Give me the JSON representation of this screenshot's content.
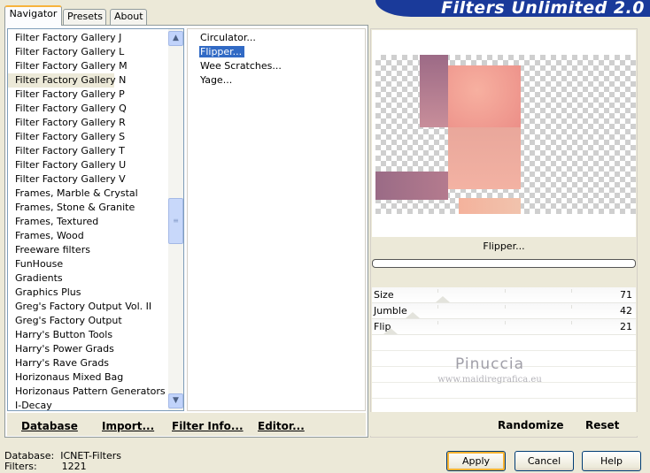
{
  "tabs": [
    "Navigator",
    "Presets",
    "About"
  ],
  "banner_title": "Filters Unlimited 2.0",
  "categories": [
    "Filter Factory Gallery J",
    "Filter Factory Gallery L",
    "Filter Factory Gallery M",
    "Filter Factory Gallery N",
    "Filter Factory Gallery P",
    "Filter Factory Gallery Q",
    "Filter Factory Gallery R",
    "Filter Factory Gallery S",
    "Filter Factory Gallery T",
    "Filter Factory Gallery U",
    "Filter Factory Gallery V",
    "Frames, Marble & Crystal",
    "Frames, Stone & Granite",
    "Frames, Textured",
    "Frames, Wood",
    "Freeware filters",
    "FunHouse",
    "Gradients",
    "Graphics Plus",
    "Greg's Factory Output Vol. II",
    "Greg's Factory Output",
    "Harry's Button Tools",
    "Harry's Power Grads",
    "Harry's Rave Grads",
    "Horizonaus Mixed Bag",
    "Horizonaus Pattern Generators",
    "I-Decay"
  ],
  "selected_category": "Filter Factory Gallery N",
  "filters": [
    "Circulator...",
    "Flipper...",
    "Wee Scratches...",
    "Yage..."
  ],
  "selected_filter": "Flipper...",
  "left_buttons": {
    "database": "Database",
    "import": "Import...",
    "filter_info": "Filter Info...",
    "editor": "Editor..."
  },
  "preview_filter_name": "Flipper...",
  "progress": 0,
  "params": [
    {
      "name": "Size",
      "value": "71"
    },
    {
      "name": "Jumble",
      "value": "42"
    },
    {
      "name": "Flip",
      "value": "21"
    }
  ],
  "watermark": {
    "line1": "Pinuccia",
    "line2": "www.maidiregrafica.eu"
  },
  "right_buttons": {
    "randomize": "Randomize",
    "reset": "Reset"
  },
  "status": {
    "database_label": "Database:",
    "database_value": "ICNET-Filters",
    "filters_label": "Filters:",
    "filters_value": "1221"
  },
  "dialog_buttons": {
    "apply": "Apply",
    "cancel": "Cancel",
    "help": "Help"
  },
  "colors": {
    "banner": "#1a3a9a",
    "selection": "#316ac5",
    "accent_block": "#f4a396",
    "mauve_block": "#a06f86"
  }
}
